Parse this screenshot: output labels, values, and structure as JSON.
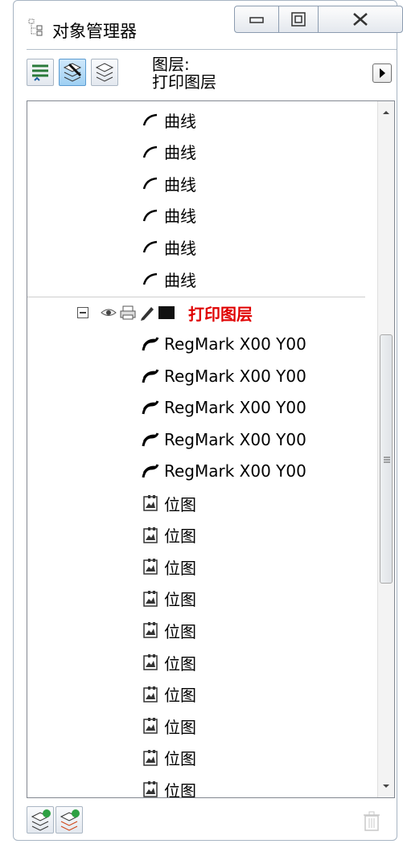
{
  "window": {
    "title": "对象管理器"
  },
  "toolbar": {
    "layer_label_line1": "图层:",
    "layer_label_line2": "打印图层"
  },
  "tree": {
    "curves": [
      "曲线",
      "曲线",
      "曲线",
      "曲线",
      "曲线",
      "曲线"
    ],
    "layer": {
      "name": "打印图层",
      "color": "#e00000"
    },
    "regmarks": [
      "RegMark X00 Y00",
      "RegMark X00 Y00",
      "RegMark X00 Y00",
      "RegMark X00 Y00",
      "RegMark X00 Y00"
    ],
    "bitmaps": [
      "位图",
      "位图",
      "位图",
      "位图",
      "位图",
      "位图",
      "位图",
      "位图",
      "位图",
      "位图"
    ]
  },
  "colors": {
    "accent": "#9fd0f3",
    "layer_red": "#e00000",
    "border": "#a7b4c3"
  }
}
